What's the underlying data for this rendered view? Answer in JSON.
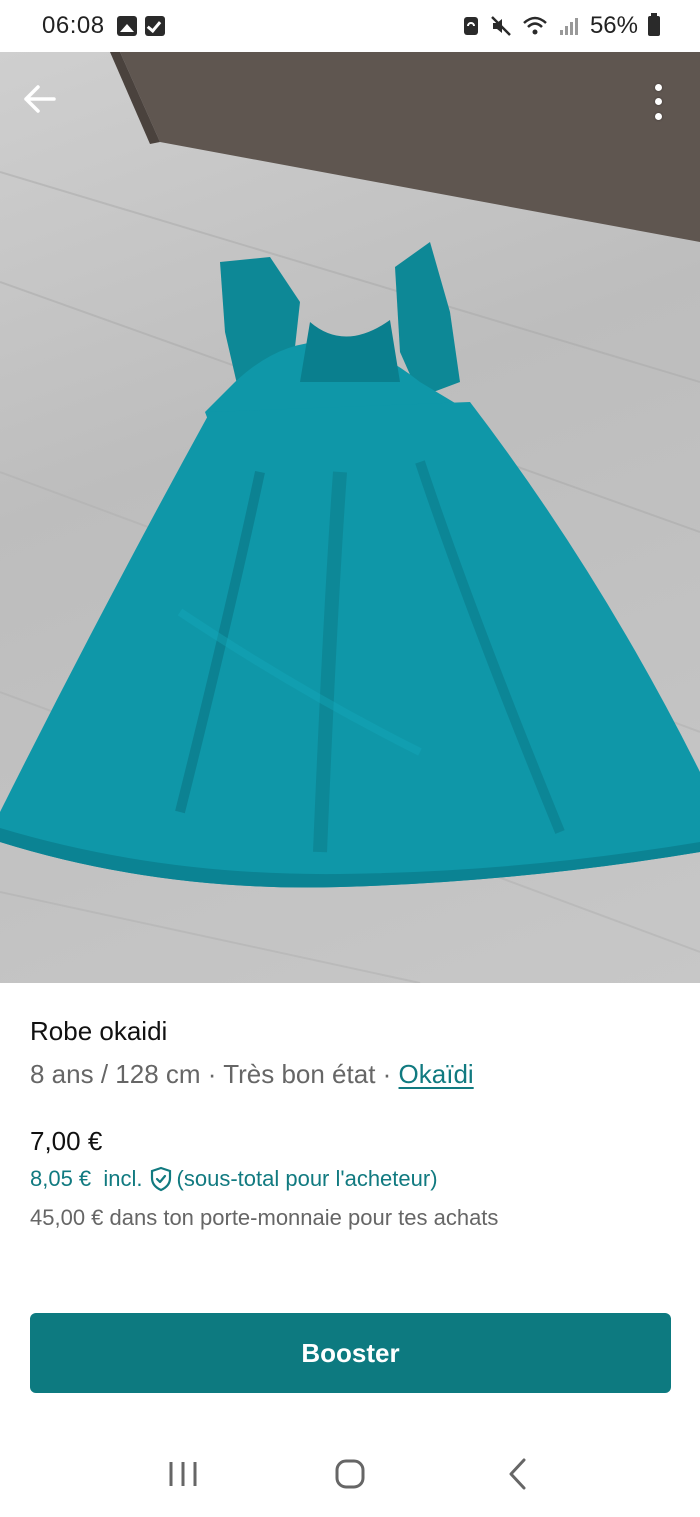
{
  "status_bar": {
    "time": "06:08",
    "left_icons": [
      "image-icon",
      "check-square-icon"
    ],
    "right_icons": [
      "sync-icon",
      "mute-icon",
      "wifi-icon",
      "signal-icon"
    ],
    "battery": "56%"
  },
  "photo": {
    "description_icons": [
      "back-arrow-icon",
      "more-vert-icon"
    ]
  },
  "item": {
    "title": "Robe okaidi",
    "size": "8 ans / 128 cm",
    "sep1": " · ",
    "condition": "Très bon état",
    "sep2": " · ",
    "brand": "Okaïdi",
    "price": "7,00 €",
    "buyer_price": "8,05 €",
    "buyer_incl": "incl.",
    "buyer_note": "(sous-total pour l'acheteur)",
    "wallet_note": "45,00 € dans ton porte-monnaie pour tes achats"
  },
  "actions": {
    "booster_label": "Booster"
  },
  "colors": {
    "accent": "#0d7a80",
    "link": "#117a80",
    "dress": "#0f97a8"
  }
}
